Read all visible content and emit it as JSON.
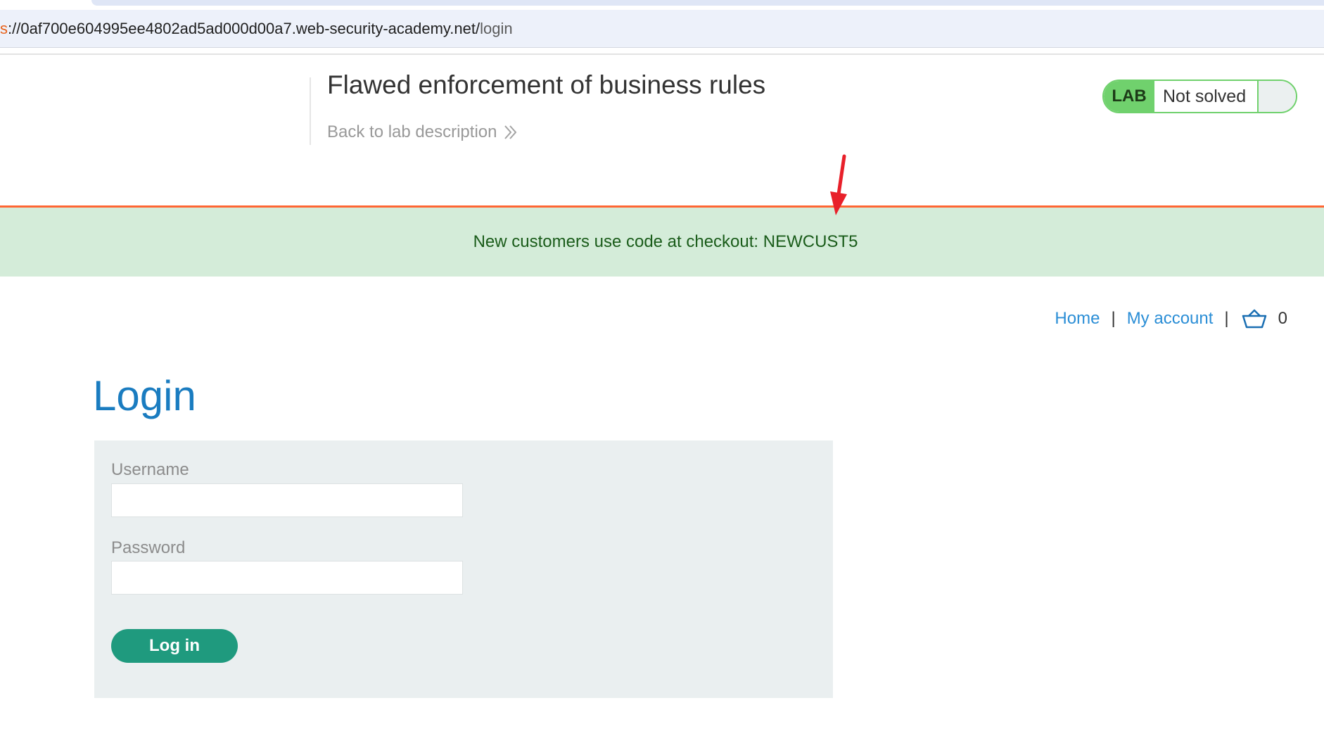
{
  "browser": {
    "url_scheme_fragment": "s",
    "url_host": "://0af700e604995ee4802ad5ad000d00a7.web-security-academy.net/",
    "url_path": "login"
  },
  "lab_header": {
    "title": "Flawed enforcement of business rules",
    "back_link": "Back to lab description",
    "status_badge": "LAB",
    "status_text": "Not solved",
    "status_color": "#70d16d"
  },
  "banner": {
    "message": "New customers use code at checkout: NEWCUST5",
    "accent_color": "#ff6633",
    "background_color": "#d4ecd9"
  },
  "nav": {
    "home": "Home",
    "separator": "|",
    "my_account": "My account",
    "cart_icon": "basket-icon",
    "cart_count": "0"
  },
  "login": {
    "heading": "Login",
    "username_label": "Username",
    "username_value": "",
    "password_label": "Password",
    "password_value": "",
    "submit_label": "Log in",
    "button_color": "#1f9a7e"
  }
}
